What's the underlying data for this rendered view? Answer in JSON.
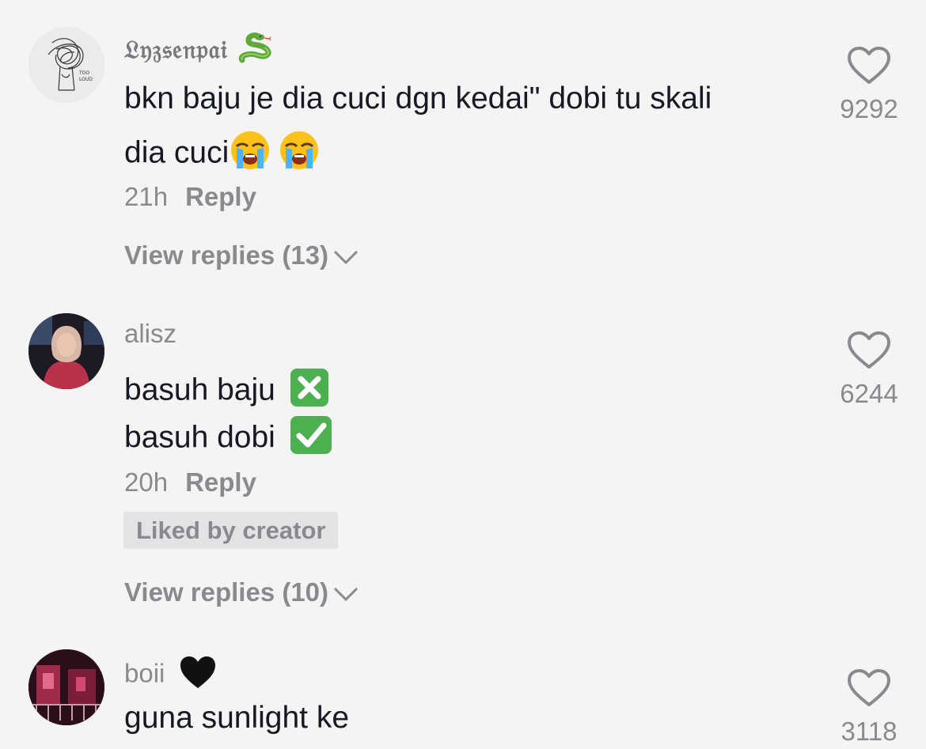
{
  "comments": [
    {
      "username": "𝔏𝔶𝔷𝔰𝔢𝔫𝔭𝔞𝔦",
      "username_emoji": "snake-emoji",
      "lines": [
        "bkn baju je dia cuci dgn kedai\" dobi tu skali",
        "dia cuci"
      ],
      "line_emojis": [
        "loudly-crying-face-emoji",
        "loudly-crying-face-emoji"
      ],
      "time": "21h",
      "reply_label": "Reply",
      "view_replies": "View replies (13)",
      "likes": "9292"
    },
    {
      "username": "alisz",
      "lines": [
        "basuh baju",
        "basuh dobi"
      ],
      "line_emojis": [
        "cross-mark-button-emoji",
        "check-mark-button-emoji"
      ],
      "time": "20h",
      "reply_label": "Reply",
      "badge": "Liked by creator",
      "view_replies": "View replies (10)",
      "likes": "6244"
    },
    {
      "username": "boii",
      "username_emoji": "black-heart-emoji",
      "lines": [
        "guna sunlight ke"
      ],
      "likes": "3118"
    }
  ],
  "colors": {
    "background": "#f4f4f5",
    "text": "#161823",
    "muted": "#8a8a8e",
    "badge_bg": "#e3e3e5",
    "check_green": "#4caf50"
  }
}
